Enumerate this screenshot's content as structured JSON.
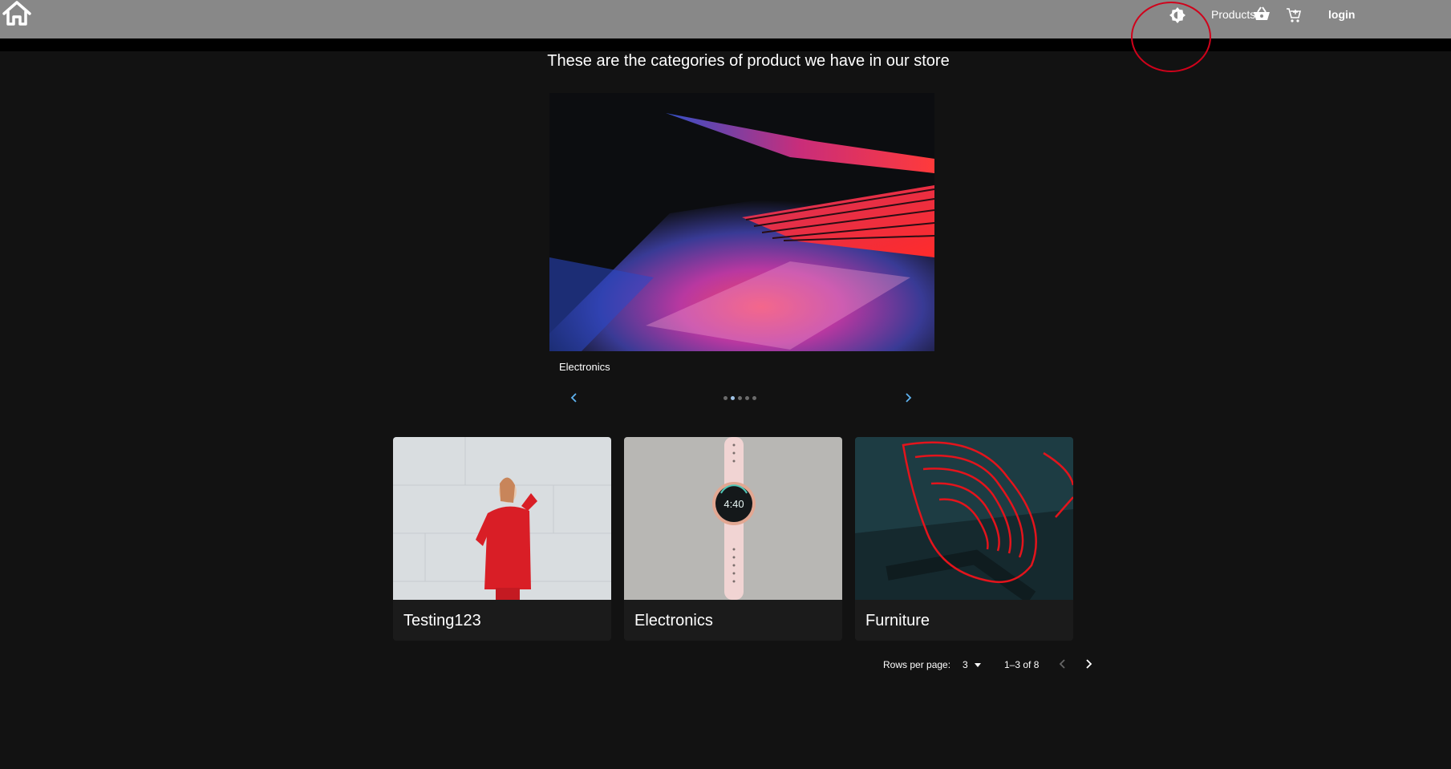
{
  "appbar": {
    "home_icon": "home-icon",
    "theme_icon": "brightness-icon",
    "products_label": "Products",
    "basket_icon": "basket-icon",
    "cart_icon": "cart-icon",
    "login_label": "login"
  },
  "main": {
    "heading": "These are the categories of product we have in our store"
  },
  "carousel": {
    "caption": "Electronics",
    "prev_icon": "chevron-left-icon",
    "next_icon": "chevron-right-icon",
    "dots_total": 5,
    "active_dot": 2
  },
  "cards": [
    {
      "title": "Testing123"
    },
    {
      "title": "Electronics"
    },
    {
      "title": "Furniture"
    }
  ],
  "pagination": {
    "rows_label": "Rows per page:",
    "rows_value": "3",
    "range": "1–3 of 8"
  },
  "colors": {
    "appbar": "#888888",
    "background": "#121212",
    "card": "#1b1b1b",
    "annotation": "#d0021b"
  }
}
